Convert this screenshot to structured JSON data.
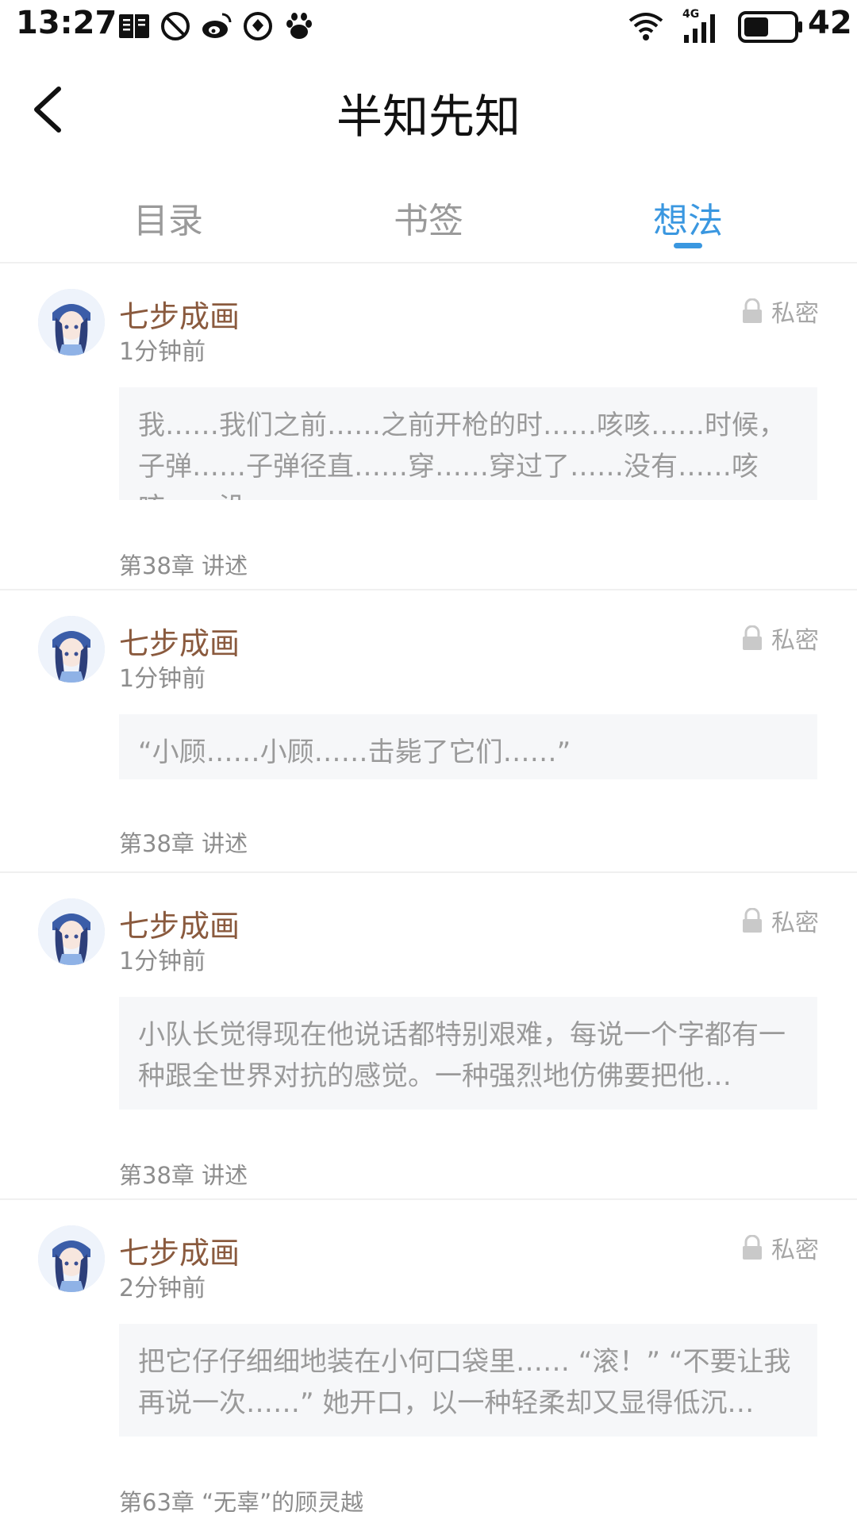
{
  "status_bar": {
    "time": "13:27",
    "network": "4G",
    "battery": "42",
    "icons": [
      "reader-icon",
      "no-disturb-icon",
      "weibo-icon",
      "messenger-icon",
      "baidu-icon",
      "wifi-icon",
      "signal-icon",
      "battery-icon"
    ]
  },
  "header": {
    "title": "半知先知"
  },
  "tabs": [
    {
      "label": "目录"
    },
    {
      "label": "书签"
    },
    {
      "label": "想法"
    }
  ],
  "notes": [
    {
      "user": "七步成画",
      "time": "1分钟前",
      "privacy": "私密",
      "excerpt": "我……我们之前……之前开枪的时……咳咳……时候，子弹……子弹径直……穿……穿过了……没有……咳咳……没…",
      "chapter": "第38章 讲述"
    },
    {
      "user": "七步成画",
      "time": "1分钟前",
      "privacy": "私密",
      "excerpt": "“小顾……小顾……击毙了它们……”",
      "chapter": "第38章 讲述"
    },
    {
      "user": "七步成画",
      "time": "1分钟前",
      "privacy": "私密",
      "excerpt": "小队长觉得现在他说话都特别艰难，每说一个字都有一种跟全世界对抗的感觉。一种强烈地仿佛要把他…",
      "chapter": "第38章 讲述"
    },
    {
      "user": "七步成画",
      "time": "2分钟前",
      "privacy": "私密",
      "excerpt": "把它仔仔细细地装在小何口袋里…… “滚！” “不要让我再说一次……” 她开口，以一种轻柔却又显得低沉…",
      "chapter": "第63章 “无辜”的顾灵越"
    }
  ],
  "colors": {
    "accent": "#3a97e0",
    "username": "#8a5a3e",
    "muted": "#8d8d8d",
    "excerpt_bg": "#f6f7f9"
  }
}
